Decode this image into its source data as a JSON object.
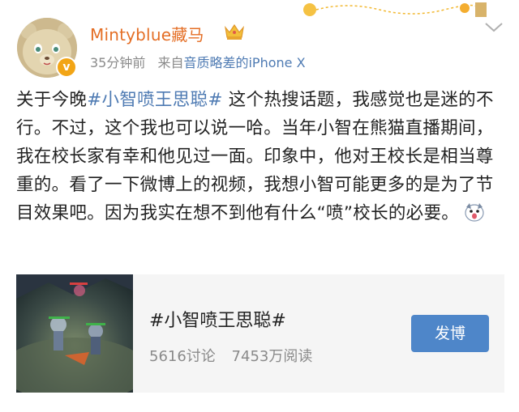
{
  "user": {
    "name": "Mintyblue藏马",
    "time": "35分钟前",
    "source_prefix": "来自",
    "source": "音质略差的iPhone X"
  },
  "post": {
    "t1": "关于今晚",
    "hashtag": "#小智喷王思聪#",
    "t2": " 这个热搜话题，我感觉也是迷的不行。不过，这个我也可以说一哈。当年小智在熊猫直播期间，我在校长家有幸和他见过一面。印象中，他对王校长是相当尊重的。看了一下微博上的视频，我想小智可能更多的是为了节目效果吧。因为我实在想不到他有什么“喷”校长的必要。"
  },
  "topic_card": {
    "title": "#小智喷王思聪#",
    "discussions": "5616讨论",
    "reads": "7453万阅读",
    "button": "发博"
  },
  "colors": {
    "username": "#e46e25",
    "link": "#4f7bb3",
    "button": "#4e86c9",
    "meta": "#8a8a8a"
  },
  "icons": [
    "bear-avatar",
    "verified-icon",
    "crown-icon",
    "chevron-down-icon",
    "emoji-icon"
  ]
}
